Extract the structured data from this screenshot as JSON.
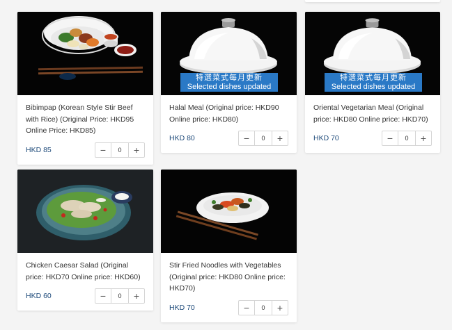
{
  "currency_note": "HKD",
  "banner": {
    "zh": "特選菜式每月更新",
    "en": "Selected dishes updated"
  },
  "products": [
    {
      "title": "Bibimpap (Korean Style Stir Beef with Rice) (Original Price: HKD95 Online Price: HKD85)",
      "price": "HKD 85",
      "qty": "0",
      "image": "bibimbap-photo"
    },
    {
      "title": "Halal Meal (Original price: HKD90 Online price: HKD80)",
      "price": "HKD 80",
      "qty": "0",
      "image": "cloche-photo"
    },
    {
      "title": "Oriental Vegetarian Meal (Original price: HKD80 Online price: HKD70)",
      "price": "HKD 70",
      "qty": "0",
      "image": "cloche-photo"
    },
    {
      "title": "Chicken Caesar Salad (Original price: HKD70 Online price: HKD60)",
      "price": "HKD 60",
      "qty": "0",
      "image": "salad-photo"
    },
    {
      "title": "Stir Fried Noodles with Vegetables (Original price: HKD80 Online price: HKD70)",
      "price": "HKD 70",
      "qty": "0",
      "image": "noodles-photo"
    }
  ],
  "stepper": {
    "minus": "−",
    "plus": "+"
  }
}
